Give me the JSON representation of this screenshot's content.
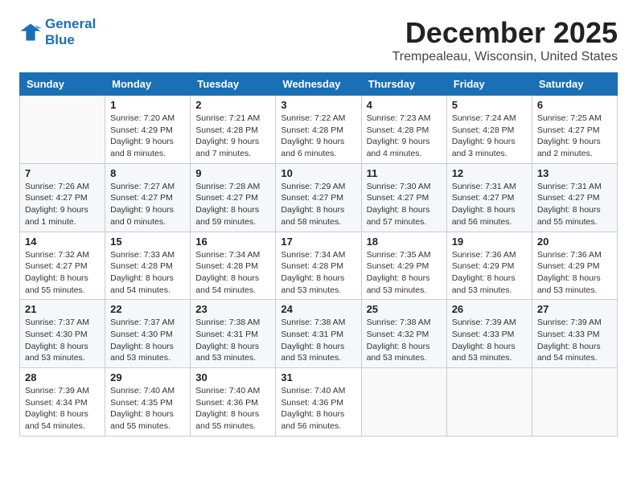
{
  "logo": {
    "line1": "General",
    "line2": "Blue"
  },
  "title": "December 2025",
  "location": "Trempealeau, Wisconsin, United States",
  "days_of_week": [
    "Sunday",
    "Monday",
    "Tuesday",
    "Wednesday",
    "Thursday",
    "Friday",
    "Saturday"
  ],
  "weeks": [
    [
      {
        "day": "",
        "detail": ""
      },
      {
        "day": "1",
        "detail": "Sunrise: 7:20 AM\nSunset: 4:29 PM\nDaylight: 9 hours\nand 8 minutes."
      },
      {
        "day": "2",
        "detail": "Sunrise: 7:21 AM\nSunset: 4:28 PM\nDaylight: 9 hours\nand 7 minutes."
      },
      {
        "day": "3",
        "detail": "Sunrise: 7:22 AM\nSunset: 4:28 PM\nDaylight: 9 hours\nand 6 minutes."
      },
      {
        "day": "4",
        "detail": "Sunrise: 7:23 AM\nSunset: 4:28 PM\nDaylight: 9 hours\nand 4 minutes."
      },
      {
        "day": "5",
        "detail": "Sunrise: 7:24 AM\nSunset: 4:28 PM\nDaylight: 9 hours\nand 3 minutes."
      },
      {
        "day": "6",
        "detail": "Sunrise: 7:25 AM\nSunset: 4:27 PM\nDaylight: 9 hours\nand 2 minutes."
      }
    ],
    [
      {
        "day": "7",
        "detail": "Sunrise: 7:26 AM\nSunset: 4:27 PM\nDaylight: 9 hours\nand 1 minute."
      },
      {
        "day": "8",
        "detail": "Sunrise: 7:27 AM\nSunset: 4:27 PM\nDaylight: 9 hours\nand 0 minutes."
      },
      {
        "day": "9",
        "detail": "Sunrise: 7:28 AM\nSunset: 4:27 PM\nDaylight: 8 hours\nand 59 minutes."
      },
      {
        "day": "10",
        "detail": "Sunrise: 7:29 AM\nSunset: 4:27 PM\nDaylight: 8 hours\nand 58 minutes."
      },
      {
        "day": "11",
        "detail": "Sunrise: 7:30 AM\nSunset: 4:27 PM\nDaylight: 8 hours\nand 57 minutes."
      },
      {
        "day": "12",
        "detail": "Sunrise: 7:31 AM\nSunset: 4:27 PM\nDaylight: 8 hours\nand 56 minutes."
      },
      {
        "day": "13",
        "detail": "Sunrise: 7:31 AM\nSunset: 4:27 PM\nDaylight: 8 hours\nand 55 minutes."
      }
    ],
    [
      {
        "day": "14",
        "detail": "Sunrise: 7:32 AM\nSunset: 4:27 PM\nDaylight: 8 hours\nand 55 minutes."
      },
      {
        "day": "15",
        "detail": "Sunrise: 7:33 AM\nSunset: 4:28 PM\nDaylight: 8 hours\nand 54 minutes."
      },
      {
        "day": "16",
        "detail": "Sunrise: 7:34 AM\nSunset: 4:28 PM\nDaylight: 8 hours\nand 54 minutes."
      },
      {
        "day": "17",
        "detail": "Sunrise: 7:34 AM\nSunset: 4:28 PM\nDaylight: 8 hours\nand 53 minutes."
      },
      {
        "day": "18",
        "detail": "Sunrise: 7:35 AM\nSunset: 4:29 PM\nDaylight: 8 hours\nand 53 minutes."
      },
      {
        "day": "19",
        "detail": "Sunrise: 7:36 AM\nSunset: 4:29 PM\nDaylight: 8 hours\nand 53 minutes."
      },
      {
        "day": "20",
        "detail": "Sunrise: 7:36 AM\nSunset: 4:29 PM\nDaylight: 8 hours\nand 53 minutes."
      }
    ],
    [
      {
        "day": "21",
        "detail": "Sunrise: 7:37 AM\nSunset: 4:30 PM\nDaylight: 8 hours\nand 53 minutes."
      },
      {
        "day": "22",
        "detail": "Sunrise: 7:37 AM\nSunset: 4:30 PM\nDaylight: 8 hours\nand 53 minutes."
      },
      {
        "day": "23",
        "detail": "Sunrise: 7:38 AM\nSunset: 4:31 PM\nDaylight: 8 hours\nand 53 minutes."
      },
      {
        "day": "24",
        "detail": "Sunrise: 7:38 AM\nSunset: 4:31 PM\nDaylight: 8 hours\nand 53 minutes."
      },
      {
        "day": "25",
        "detail": "Sunrise: 7:38 AM\nSunset: 4:32 PM\nDaylight: 8 hours\nand 53 minutes."
      },
      {
        "day": "26",
        "detail": "Sunrise: 7:39 AM\nSunset: 4:33 PM\nDaylight: 8 hours\nand 53 minutes."
      },
      {
        "day": "27",
        "detail": "Sunrise: 7:39 AM\nSunset: 4:33 PM\nDaylight: 8 hours\nand 54 minutes."
      }
    ],
    [
      {
        "day": "28",
        "detail": "Sunrise: 7:39 AM\nSunset: 4:34 PM\nDaylight: 8 hours\nand 54 minutes."
      },
      {
        "day": "29",
        "detail": "Sunrise: 7:40 AM\nSunset: 4:35 PM\nDaylight: 8 hours\nand 55 minutes."
      },
      {
        "day": "30",
        "detail": "Sunrise: 7:40 AM\nSunset: 4:36 PM\nDaylight: 8 hours\nand 55 minutes."
      },
      {
        "day": "31",
        "detail": "Sunrise: 7:40 AM\nSunset: 4:36 PM\nDaylight: 8 hours\nand 56 minutes."
      },
      {
        "day": "",
        "detail": ""
      },
      {
        "day": "",
        "detail": ""
      },
      {
        "day": "",
        "detail": ""
      }
    ]
  ]
}
